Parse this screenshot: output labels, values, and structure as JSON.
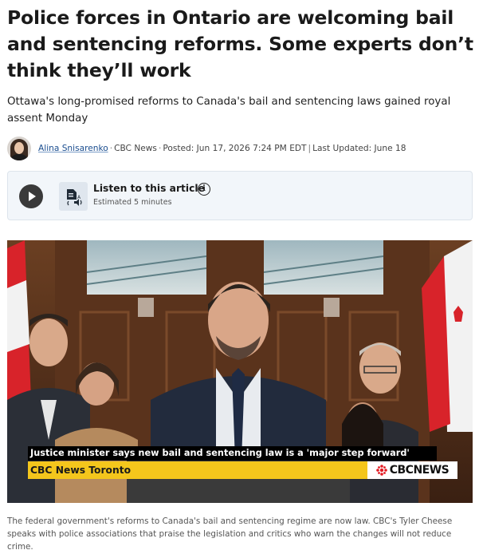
{
  "article": {
    "headline": "Police forces in Ontario are welcoming bail and sentencing reforms. Some experts don’t think they’ll work",
    "dek": "Ottawa's long-promised reforms to Canada's bail and sentencing laws gained royal assent Monday"
  },
  "byline": {
    "author": "Alina Snisarenko",
    "outlet": "CBC News",
    "posted": "Posted: Jun 17, 2026 7:24 PM EDT",
    "updated": "Last Updated: June 18",
    "separator_dot": "·",
    "separator_bar": "|"
  },
  "listen": {
    "title": "Listen to this article",
    "estimate": "Estimated 5 minutes",
    "play_icon": "play-icon",
    "tts_icon": "text-to-speech-icon",
    "info_icon": "info-icon",
    "info_glyph": "i"
  },
  "video": {
    "caption": "Justice minister says new bail and sentencing law is a 'major step forward'",
    "station": "CBC News Toronto",
    "logo_text": "CBCNEWS"
  },
  "photo_caption": "The federal government's reforms to Canada's bail and sentencing regime are now law. CBC's Tyler Cheese speaks with police associations that praise the legislation and critics who warn the changes will not reduce crime.",
  "colors": {
    "accent_yellow": "#f4c61c",
    "author_link": "#1a4d8f",
    "cbc_red": "#e31b23",
    "listen_bg": "#f2f6fa"
  }
}
